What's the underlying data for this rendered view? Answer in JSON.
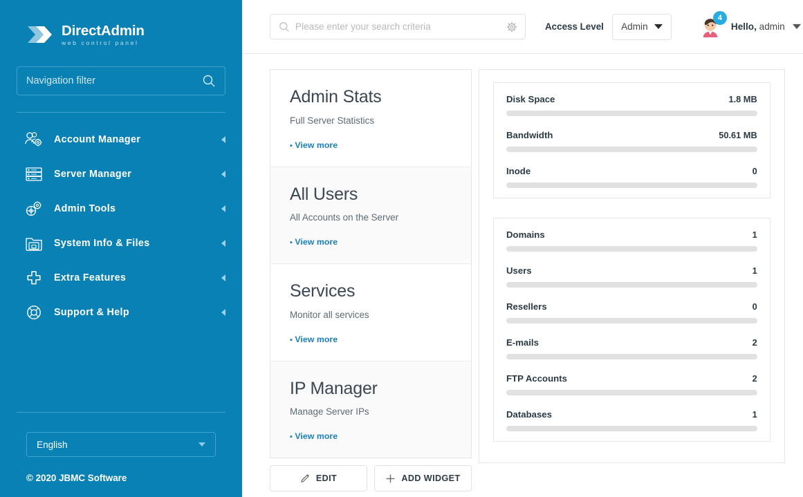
{
  "sidebar": {
    "logo": {
      "title_bold": "Direct",
      "title_light": "Admin",
      "subtitle": "web control panel",
      "icon": "double-chevron-logo-icon"
    },
    "nav_filter": {
      "placeholder": "Navigation filter",
      "value": "",
      "icon": "search-icon"
    },
    "items": [
      {
        "label": "Account Manager",
        "icon": "users-gear-icon"
      },
      {
        "label": "Server Manager",
        "icon": "server-rack-icon"
      },
      {
        "label": "Admin Tools",
        "icon": "gears-icon"
      },
      {
        "label": "System Info & Files",
        "icon": "folder-files-icon"
      },
      {
        "label": "Extra Features",
        "icon": "plus-cross-icon"
      },
      {
        "label": "Support & Help",
        "icon": "lifebuoy-icon"
      }
    ],
    "language": {
      "selected": "English",
      "icon": "chevron-down-icon"
    },
    "copyright": "© 2020 JBMC Software"
  },
  "topbar": {
    "search": {
      "placeholder": "Please enter your search criteria",
      "value": "",
      "icon": "search-icon",
      "settings_icon": "gear-icon"
    },
    "access_level_label": "Access Level",
    "access_level_value": "Admin",
    "user": {
      "greeting_bold": "Hello,",
      "name": "admin",
      "badge_count": "4",
      "avatar": "user-avatar"
    }
  },
  "widgets": [
    {
      "title": "Admin Stats",
      "desc": "Full Server Statistics",
      "more": "View more"
    },
    {
      "title": "All Users",
      "desc": "All Accounts on the Server",
      "more": "View more"
    },
    {
      "title": "Services",
      "desc": "Monitor all services",
      "more": "View more"
    },
    {
      "title": "IP Manager",
      "desc": "Manage Server IPs",
      "more": "View more"
    }
  ],
  "widget_actions": {
    "edit": "EDIT",
    "edit_icon": "pencil-icon",
    "add": "ADD WIDGET",
    "add_icon": "plus-icon"
  },
  "stats": {
    "usage": [
      {
        "label": "Disk Space",
        "value": "1.8 MB",
        "percent": 0
      },
      {
        "label": "Bandwidth",
        "value": "50.61 MB",
        "percent": 0
      },
      {
        "label": "Inode",
        "value": "0",
        "percent": 0
      }
    ],
    "counts": [
      {
        "label": "Domains",
        "value": "1",
        "percent": 0
      },
      {
        "label": "Users",
        "value": "1",
        "percent": 0
      },
      {
        "label": "Resellers",
        "value": "0",
        "percent": 0
      },
      {
        "label": "E-mails",
        "value": "2",
        "percent": 0
      },
      {
        "label": "FTP Accounts",
        "value": "2",
        "percent": 0
      },
      {
        "label": "Databases",
        "value": "1",
        "percent": 0
      }
    ]
  },
  "colors": {
    "brand_blue": "#0a81b5",
    "accent_blue": "#29abe2",
    "link_blue": "#1a7fbd",
    "bar_track": "#e1e1e1"
  }
}
